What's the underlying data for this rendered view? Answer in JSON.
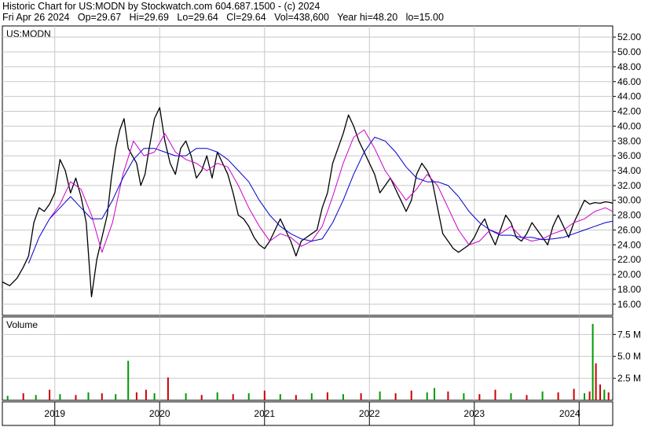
{
  "header": {
    "line1": "Historic Chart for US:MODN by Stockwatch.com 604.687.1500 - (c) 2024",
    "line2": "Fri Apr 26 2024   Op=29.67   Hi=29.69   Lo=29.64   Cl=29.64   Vol=438,600   Year hi=48.20   lo=15.00"
  },
  "chart_data": [
    {
      "type": "line",
      "title": "US:MODN",
      "ylim": [
        14.5,
        53.5
      ],
      "yticks": [
        16,
        18,
        20,
        22,
        24,
        26,
        28,
        30,
        32,
        34,
        36,
        38,
        40,
        42,
        44,
        46,
        48,
        50,
        52
      ],
      "ytick_labels": [
        "16.00",
        "18.00",
        "20.00",
        "22.00",
        "24.00",
        "26.00",
        "28.00",
        "30.00",
        "32.00",
        "34.00",
        "36.00",
        "38.00",
        "40.00",
        "42.00",
        "44.00",
        "46.00",
        "48.00",
        "50.00",
        "52.00"
      ],
      "xticks": [
        "2019",
        "2020",
        "2021",
        "2022",
        "2023",
        "2024"
      ],
      "grid": true,
      "x_range": [
        2018.5,
        2024.32
      ],
      "series": [
        {
          "kind": "price",
          "color": "#000000",
          "x": [
            2018.5,
            2018.57,
            2018.64,
            2018.7,
            2018.75,
            2018.8,
            2018.85,
            2018.9,
            2018.95,
            2019.0,
            2019.05,
            2019.1,
            2019.15,
            2019.2,
            2019.25,
            2019.3,
            2019.35,
            2019.4,
            2019.45,
            2019.5,
            2019.54,
            2019.58,
            2019.62,
            2019.66,
            2019.7,
            2019.74,
            2019.78,
            2019.82,
            2019.86,
            2019.9,
            2019.95,
            2020.0,
            2020.05,
            2020.1,
            2020.15,
            2020.2,
            2020.25,
            2020.3,
            2020.35,
            2020.4,
            2020.45,
            2020.5,
            2020.55,
            2020.6,
            2020.65,
            2020.7,
            2020.75,
            2020.8,
            2020.85,
            2020.9,
            2020.95,
            2021.0,
            2021.05,
            2021.1,
            2021.15,
            2021.2,
            2021.25,
            2021.3,
            2021.35,
            2021.4,
            2021.45,
            2021.5,
            2021.55,
            2021.6,
            2021.65,
            2021.7,
            2021.75,
            2021.8,
            2021.85,
            2021.9,
            2021.95,
            2022.0,
            2022.05,
            2022.1,
            2022.15,
            2022.2,
            2022.25,
            2022.3,
            2022.35,
            2022.4,
            2022.45,
            2022.5,
            2022.55,
            2022.6,
            2022.65,
            2022.7,
            2022.75,
            2022.8,
            2022.85,
            2022.9,
            2022.95,
            2023.0,
            2023.05,
            2023.1,
            2023.15,
            2023.2,
            2023.25,
            2023.3,
            2023.35,
            2023.4,
            2023.45,
            2023.5,
            2023.55,
            2023.6,
            2023.65,
            2023.7,
            2023.75,
            2023.8,
            2023.85,
            2023.9,
            2023.95,
            2024.0,
            2024.05,
            2024.1,
            2024.15,
            2024.2,
            2024.25,
            2024.3,
            2024.32
          ],
          "values": [
            19.0,
            18.5,
            19.5,
            21.0,
            22.5,
            27.0,
            29.0,
            28.5,
            29.5,
            31.0,
            35.5,
            34.0,
            31.0,
            33.0,
            30.5,
            27.0,
            17.0,
            22.0,
            25.0,
            28.0,
            33.0,
            37.0,
            39.5,
            41.0,
            37.0,
            36.0,
            35.0,
            32.0,
            33.5,
            37.0,
            41.0,
            42.5,
            38.0,
            35.0,
            33.5,
            37.0,
            38.0,
            36.0,
            33.0,
            34.0,
            36.0,
            33.0,
            36.5,
            35.0,
            33.5,
            31.0,
            28.0,
            27.5,
            26.5,
            25.0,
            24.0,
            23.5,
            24.5,
            26.0,
            27.5,
            26.0,
            24.5,
            22.5,
            24.5,
            25.0,
            25.5,
            26.0,
            29.0,
            31.0,
            35.0,
            37.0,
            39.0,
            41.5,
            40.0,
            38.0,
            36.5,
            35.0,
            33.5,
            31.0,
            32.0,
            33.0,
            31.5,
            30.0,
            28.5,
            30.0,
            33.5,
            35.0,
            34.0,
            32.5,
            29.0,
            25.5,
            24.5,
            23.5,
            23.0,
            23.5,
            24.0,
            25.0,
            26.5,
            27.5,
            25.5,
            24.0,
            26.0,
            28.0,
            27.0,
            25.0,
            24.5,
            25.5,
            27.0,
            26.0,
            25.0,
            24.0,
            26.5,
            28.0,
            26.5,
            25.0,
            27.0,
            28.5,
            30.0,
            29.5,
            29.7,
            29.6,
            29.8,
            29.7,
            29.6
          ]
        },
        {
          "kind": "ma-short",
          "color": "#cc00cc",
          "x": [
            2018.95,
            2019.05,
            2019.15,
            2019.25,
            2019.35,
            2019.45,
            2019.55,
            2019.65,
            2019.75,
            2019.85,
            2019.95,
            2020.05,
            2020.15,
            2020.25,
            2020.35,
            2020.45,
            2020.55,
            2020.65,
            2020.75,
            2020.85,
            2020.95,
            2021.05,
            2021.15,
            2021.25,
            2021.35,
            2021.45,
            2021.55,
            2021.65,
            2021.75,
            2021.85,
            2021.95,
            2022.05,
            2022.15,
            2022.25,
            2022.35,
            2022.45,
            2022.55,
            2022.65,
            2022.75,
            2022.85,
            2022.95,
            2023.05,
            2023.15,
            2023.25,
            2023.35,
            2023.45,
            2023.55,
            2023.65,
            2023.75,
            2023.85,
            2023.95,
            2024.05,
            2024.15,
            2024.25,
            2024.32
          ],
          "values": [
            27.5,
            29.5,
            32.5,
            31.5,
            28.0,
            23.0,
            27.0,
            33.5,
            38.0,
            36.0,
            36.5,
            39.0,
            36.5,
            35.5,
            35.0,
            34.0,
            35.0,
            34.5,
            32.0,
            29.0,
            26.5,
            24.5,
            25.5,
            25.0,
            23.8,
            24.5,
            26.5,
            30.5,
            35.0,
            38.5,
            39.5,
            37.0,
            34.0,
            32.0,
            30.0,
            31.5,
            33.5,
            32.0,
            29.0,
            26.0,
            24.0,
            24.5,
            26.0,
            25.5,
            26.5,
            25.0,
            24.5,
            24.8,
            25.5,
            26.0,
            27.0,
            27.5,
            28.5,
            29.0,
            28.5
          ]
        },
        {
          "kind": "ma-long",
          "color": "#0000cc",
          "x": [
            2018.75,
            2018.85,
            2018.95,
            2019.05,
            2019.15,
            2019.25,
            2019.35,
            2019.45,
            2019.55,
            2019.65,
            2019.75,
            2019.85,
            2019.95,
            2020.05,
            2020.15,
            2020.25,
            2020.35,
            2020.45,
            2020.55,
            2020.65,
            2020.75,
            2020.85,
            2020.95,
            2021.05,
            2021.15,
            2021.25,
            2021.35,
            2021.45,
            2021.55,
            2021.65,
            2021.75,
            2021.85,
            2021.95,
            2022.05,
            2022.15,
            2022.25,
            2022.35,
            2022.45,
            2022.55,
            2022.65,
            2022.75,
            2022.85,
            2022.95,
            2023.05,
            2023.15,
            2023.25,
            2023.35,
            2023.45,
            2023.55,
            2023.65,
            2023.75,
            2023.85,
            2023.95,
            2024.05,
            2024.15,
            2024.25,
            2024.32
          ],
          "values": [
            21.5,
            25.0,
            27.5,
            29.0,
            30.5,
            29.0,
            27.5,
            27.5,
            30.0,
            33.0,
            35.5,
            37.0,
            37.0,
            36.5,
            36.0,
            36.0,
            37.0,
            37.0,
            36.5,
            35.5,
            34.0,
            32.5,
            30.0,
            28.0,
            26.5,
            25.5,
            24.8,
            24.5,
            24.8,
            27.0,
            30.0,
            33.5,
            36.5,
            38.5,
            38.0,
            36.5,
            34.5,
            33.0,
            32.5,
            32.5,
            32.0,
            30.5,
            28.5,
            27.0,
            26.0,
            25.3,
            25.3,
            25.0,
            25.0,
            24.7,
            24.8,
            25.0,
            25.5,
            26.0,
            26.5,
            27.0,
            27.2
          ]
        }
      ]
    },
    {
      "type": "bar",
      "title": "Volume",
      "ylim": [
        0,
        9.5
      ],
      "yticks": [
        2.5,
        5.0,
        7.5
      ],
      "ytick_labels": [
        "2.5 M",
        "5.0 M",
        "7.5 M"
      ],
      "grid": true,
      "x_range": [
        2018.5,
        2024.32
      ],
      "x": [
        2018.55,
        2018.7,
        2018.82,
        2018.95,
        2019.05,
        2019.2,
        2019.32,
        2019.45,
        2019.58,
        2019.7,
        2019.78,
        2019.87,
        2019.95,
        2020.08,
        2020.25,
        2020.4,
        2020.55,
        2020.7,
        2020.85,
        2021.0,
        2021.15,
        2021.3,
        2021.45,
        2021.6,
        2021.75,
        2021.92,
        2022.1,
        2022.25,
        2022.4,
        2022.55,
        2022.62,
        2022.75,
        2022.9,
        2023.05,
        2023.2,
        2023.35,
        2023.5,
        2023.65,
        2023.8,
        2023.95,
        2024.05,
        2024.1,
        2024.13,
        2024.16,
        2024.2,
        2024.24,
        2024.28
      ],
      "values": [
        0.5,
        0.8,
        0.6,
        1.2,
        0.7,
        0.6,
        0.9,
        0.8,
        0.7,
        4.5,
        0.9,
        1.2,
        0.8,
        2.6,
        0.8,
        0.6,
        0.9,
        0.7,
        0.8,
        1.1,
        0.7,
        0.6,
        0.8,
        0.9,
        0.7,
        0.8,
        1.0,
        0.8,
        1.1,
        0.9,
        1.4,
        1.0,
        0.8,
        0.7,
        1.2,
        0.8,
        0.6,
        1.0,
        0.9,
        1.3,
        0.8,
        1.0,
        8.7,
        4.2,
        1.8,
        1.2,
        0.9
      ],
      "colors": [
        "#009900",
        "#cc0000",
        "#009900",
        "#cc0000",
        "#009900",
        "#cc0000",
        "#009900",
        "#cc0000",
        "#009900",
        "#009900",
        "#cc0000",
        "#cc0000",
        "#009900",
        "#cc0000",
        "#009900",
        "#cc0000",
        "#009900",
        "#cc0000",
        "#009900",
        "#cc0000",
        "#009900",
        "#cc0000",
        "#009900",
        "#cc0000",
        "#009900",
        "#cc0000",
        "#009900",
        "#cc0000",
        "#cc0000",
        "#009900",
        "#009900",
        "#cc0000",
        "#009900",
        "#cc0000",
        "#cc0000",
        "#009900",
        "#cc0000",
        "#009900",
        "#cc0000",
        "#cc0000",
        "#009900",
        "#cc0000",
        "#009900",
        "#cc0000",
        "#cc0000",
        "#009900",
        "#cc0000"
      ]
    }
  ]
}
